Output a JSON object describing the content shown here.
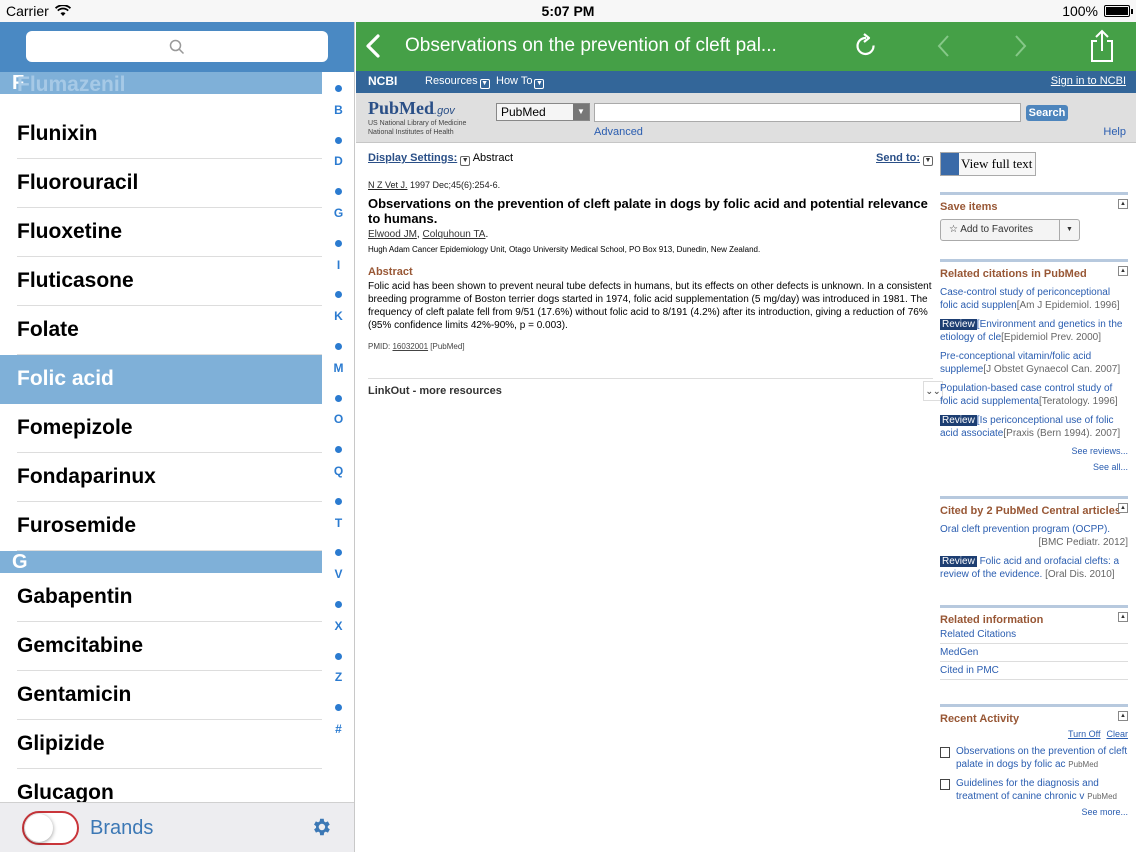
{
  "status": {
    "carrier": "Carrier",
    "time": "5:07 PM",
    "battery": "100%"
  },
  "left": {
    "search_placeholder": "",
    "ghost_item": "Flumazenil",
    "sections": [
      {
        "letter": "F",
        "items": [
          "Flunixin",
          "Fluorouracil",
          "Fluoxetine",
          "Fluticasone",
          "Folate",
          "Folic acid",
          "Fomepizole",
          "Fondaparinux",
          "Furosemide"
        ]
      },
      {
        "letter": "G",
        "items": [
          "Gabapentin",
          "Gemcitabine",
          "Gentamicin",
          "Glipizide",
          "Glucagon"
        ]
      }
    ],
    "selected": "Folic acid",
    "index": [
      "B",
      "D",
      "G",
      "I",
      "K",
      "M",
      "O",
      "Q",
      "T",
      "V",
      "X",
      "Z",
      "#"
    ],
    "footer": {
      "brands_label": "Brands",
      "toggle_on": false
    }
  },
  "browser": {
    "title": "Observations on the prevention of cleft pal...",
    "ncbi": {
      "logo": "NCBI",
      "menu1": "Resources",
      "menu2": "How To",
      "signin": "Sign in to NCBI"
    },
    "pubmed": {
      "logo": "PubMed",
      "logo_gov": ".gov",
      "logo_sub1": "US National Library of Medicine",
      "logo_sub2": "National Institutes of Health",
      "db_select": "PubMed",
      "search_value": "",
      "search_btn": "Search",
      "advanced": "Advanced",
      "help": "Help"
    },
    "article": {
      "display_settings": "Display Settings:",
      "display_value": "Abstract",
      "send_to": "Send to:",
      "journal": "N Z Vet J.",
      "citation": " 1997 Dec;45(6):254-6.",
      "title": "Observations on the prevention of cleft palate in dogs by folic acid and potential relevance to humans.",
      "author1": "Elwood JM",
      "author2": "Colquhoun TA",
      "affiliation": "Hugh Adam Cancer Epidemiology Unit, Otago University Medical School, PO Box 913, Dunedin, New Zealand.",
      "abstract_heading": "Abstract",
      "abstract": "Folic acid has been shown to prevent neural tube defects in humans, but its effects on other defects is unknown. In a consistent breeding programme of Boston terrier dogs started in 1974, folic acid supplementation (5 mg/day) was introduced in 1981. The frequency of cleft palate fell from 9/51 (17.6%) without folic acid to 8/191 (4.2%) after its introduction, giving a reduction of 76% (95% confidence limits 42%-90%, p = 0.003).",
      "pmid_label": "PMID:",
      "pmid": "16032001",
      "pmid_src": "[PubMed]",
      "linkout": "LinkOut - more resources"
    },
    "sidebar": {
      "view_full_text": "View full text",
      "save_items": "Save items",
      "add_favorites": "Add to Favorites",
      "related_heading": "Related citations in PubMed",
      "related": [
        {
          "review": "",
          "text": "Case-control study of periconceptional folic acid supplen",
          "src": "[Am J Epidemiol. 1996]"
        },
        {
          "review": "Review",
          "text": "[Environment and genetics in the etiology of cle",
          "src": "[Epidemiol Prev. 2000]"
        },
        {
          "review": "",
          "text": "Pre-conceptional vitamin/folic acid suppleme",
          "src": "[J Obstet Gynaecol Can. 2007]"
        },
        {
          "review": "",
          "text": "Population-based case control study of folic acid supplementa",
          "src": "[Teratology. 1996]"
        },
        {
          "review": "Review",
          "text": "[Is periconceptional use of folic acid associate",
          "src": "[Praxis (Bern 1994). 2007]"
        }
      ],
      "see_reviews": "See reviews...",
      "see_all": "See all...",
      "cited_heading": "Cited by 2 PubMed Central articles",
      "cited": [
        {
          "review": "",
          "text": "Oral cleft prevention program (OCPP).",
          "src": "[BMC Pediatr. 2012]"
        },
        {
          "review": "Review",
          "text": "Folic acid and orofacial clefts: a review of the evidence.",
          "src": "[Oral Dis. 2010]"
        }
      ],
      "info_heading": "Related information",
      "info": [
        "Related Citations",
        "MedGen",
        "Cited in PMC"
      ],
      "recent_heading": "Recent Activity",
      "turn_off": "Turn Off",
      "clear": "Clear",
      "recent": [
        {
          "text": "Observations on the prevention of cleft palate in dogs by folic ac",
          "src": "PubMed"
        },
        {
          "text": "Guidelines for the diagnosis and treatment of canine chronic v",
          "src": "PubMed"
        }
      ],
      "see_more": "See more..."
    }
  },
  "colors": {
    "nav_green": "#45a047",
    "list_blue": "#7fb0d8",
    "ncbi_blue": "#336699",
    "index_blue": "#2b7bd0"
  }
}
